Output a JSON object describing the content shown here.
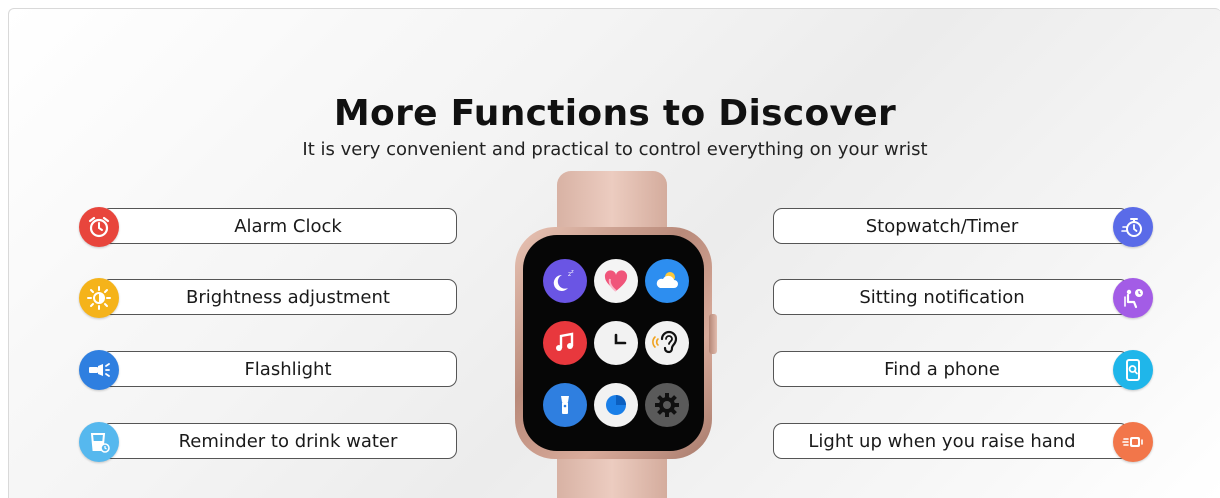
{
  "header": {
    "title": "More Functions to Discover",
    "subtitle": "It is very convenient and practical to control everything on your wrist"
  },
  "features_left": [
    {
      "label": "Alarm Clock",
      "icon": "alarm-clock-icon",
      "color": "#e8453c"
    },
    {
      "label": "Brightness adjustment",
      "icon": "brightness-icon",
      "color": "#f5b31a"
    },
    {
      "label": "Flashlight",
      "icon": "flashlight-icon",
      "color": "#2f7fe0"
    },
    {
      "label": "Reminder to drink water",
      "icon": "water-glass-icon",
      "color": "#56b8ee"
    }
  ],
  "features_right": [
    {
      "label": "Stopwatch/Timer",
      "icon": "stopwatch-icon",
      "color": "#5a6be8"
    },
    {
      "label": "Sitting notification",
      "icon": "sitting-icon",
      "color": "#a35ce6"
    },
    {
      "label": "Find a phone",
      "icon": "phone-search-icon",
      "color": "#1fb6ea"
    },
    {
      "label": "Light up when you raise hand",
      "icon": "raise-hand-icon",
      "color": "#f2764a"
    }
  ],
  "watch": {
    "apps": [
      "sleep-icon",
      "heart-icon",
      "weather-icon",
      "music-icon",
      "clock-icon",
      "hearing-icon",
      "flashlight-icon",
      "activity-icon",
      "settings-icon"
    ],
    "band_color": "#e4c0b2"
  }
}
